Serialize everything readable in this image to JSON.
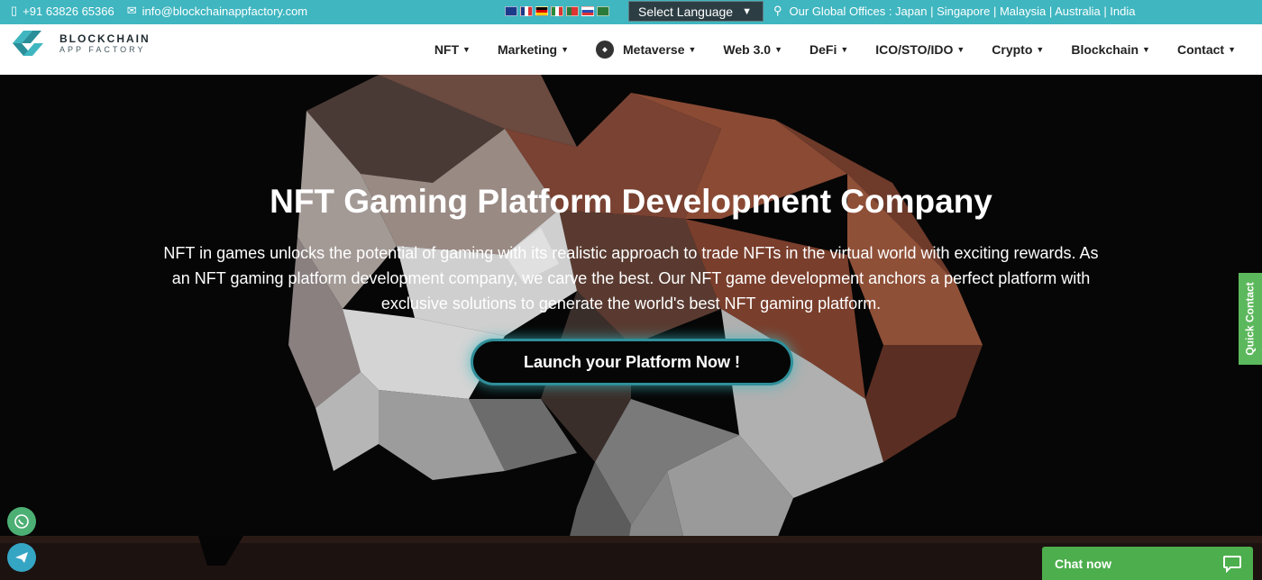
{
  "topbar": {
    "phone": "+91 63826 65366",
    "email": "info@blockchainappfactory.com",
    "language": "Select Language",
    "offices": "Our Global Offices : Japan | Singapore | Malaysia | Australia | India"
  },
  "logo": {
    "line1": "BLOCKCHAIN",
    "line2": "APP FACTORY"
  },
  "nav": {
    "items": [
      {
        "label": "NFT"
      },
      {
        "label": "Marketing"
      },
      {
        "label": "Metaverse"
      },
      {
        "label": "Web 3.0"
      },
      {
        "label": "DeFi"
      },
      {
        "label": "ICO/STO/IDO"
      },
      {
        "label": "Crypto"
      },
      {
        "label": "Blockchain"
      },
      {
        "label": "Contact"
      }
    ]
  },
  "hero": {
    "title": "NFT Gaming Platform Development Company",
    "description": "NFT in games unlocks the potential of gaming with its realistic approach to trade NFTs in the virtual world with exciting rewards. As an NFT gaming platform development company, we carve the best. Our NFT game development anchors a perfect platform with exclusive solutions to generate the world's best NFT gaming platform.",
    "cta": "Launch your Platform Now !"
  },
  "widgets": {
    "quick_contact": "Quick Contact",
    "chat": "Chat now"
  },
  "colors": {
    "topbar": "#3fb6c0",
    "accent_glow": "#2f8f9a",
    "chat": "#4cae4c"
  }
}
